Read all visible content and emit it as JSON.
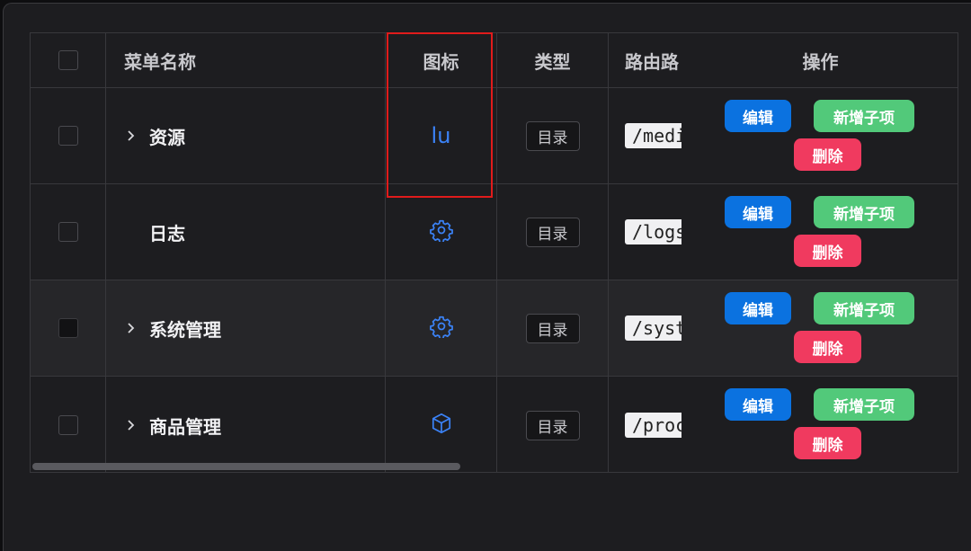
{
  "table": {
    "headers": {
      "name": "菜单名称",
      "icon": "图标",
      "type": "类型",
      "path": "路由路",
      "ops": "操作"
    },
    "rows": [
      {
        "name": "资源",
        "expandable": true,
        "icon_text": "lu",
        "icon": "text",
        "type": "目录",
        "path": "/medi"
      },
      {
        "name": "日志",
        "expandable": false,
        "icon": "gear-icon",
        "type": "目录",
        "path": "/logs"
      },
      {
        "name": "系统管理",
        "expandable": true,
        "icon": "gear-icon",
        "type": "目录",
        "path": "/syst"
      },
      {
        "name": "商品管理",
        "expandable": true,
        "icon": "cube-icon",
        "type": "目录",
        "path": "/proc"
      }
    ],
    "actions": {
      "edit": "编辑",
      "add_child": "新增子项",
      "delete": "删除"
    }
  },
  "colors": {
    "edit": "#0b72e0",
    "add_child": "#52c97a",
    "delete": "#f03a5f",
    "icon": "#3b82f6",
    "highlight": "#e01b1b"
  }
}
